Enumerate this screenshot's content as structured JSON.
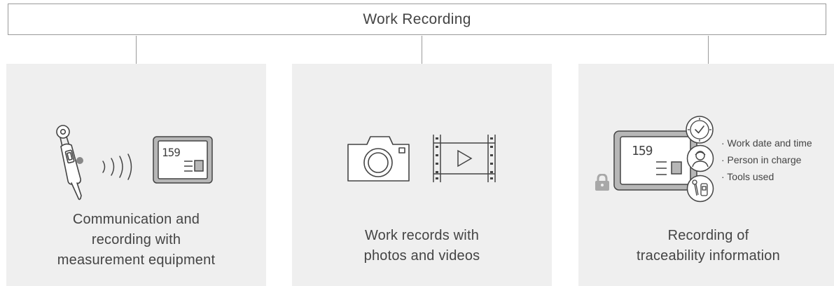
{
  "header": {
    "title": "Work Recording"
  },
  "panels": [
    {
      "caption": [
        "Communication and",
        "recording with",
        "measurement equipment"
      ]
    },
    {
      "caption": [
        "Work records with",
        "photos and videos"
      ]
    },
    {
      "caption": [
        "Recording of",
        "traceability information"
      ]
    }
  ],
  "displays": {
    "reading": "159"
  },
  "traceability_items": [
    "· Work date and time",
    "· Person in charge",
    "· Tools used"
  ]
}
